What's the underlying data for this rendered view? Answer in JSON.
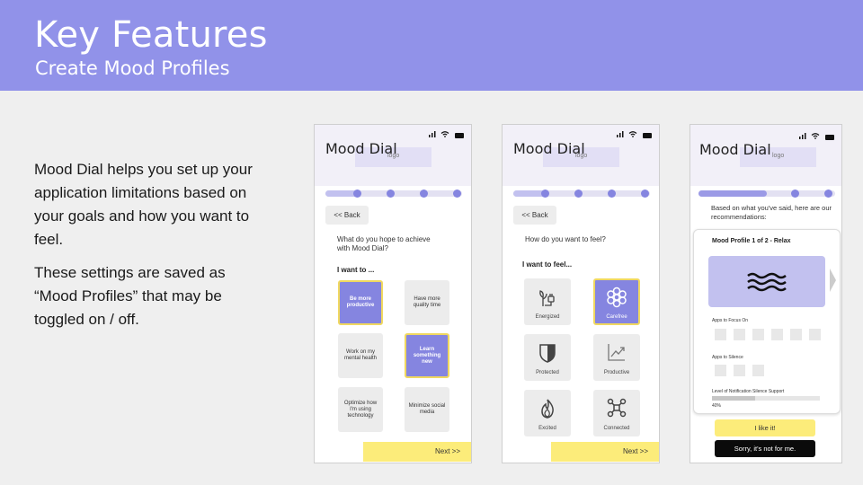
{
  "header": {
    "title": "Key Features",
    "subtitle": "Create Mood Profiles"
  },
  "description": {
    "p1": "Mood Dial helps you set up your application limitations based on your goals and how you want to feel.",
    "p2": "These settings are saved as “Mood Profiles” that may be toggled on / off."
  },
  "app": {
    "name": "Mood Dial",
    "logo_label": "logo"
  },
  "screen1": {
    "back": "<< Back",
    "question": "What do you hope to achieve with Mood Dial?",
    "prompt": "I want to ...",
    "options": [
      {
        "label": "Be more productive",
        "selected": true
      },
      {
        "label": "Have more quality time",
        "selected": false
      },
      {
        "label": "Work on my mental health",
        "selected": false
      },
      {
        "label": "Learn something new",
        "selected": true
      },
      {
        "label": "Optimize how I'm using technology",
        "selected": false
      },
      {
        "label": "Minimize social media",
        "selected": false
      }
    ],
    "next": "Next >>",
    "progress": 0.25
  },
  "screen2": {
    "back": "<< Back",
    "question": "How do you want to feel?",
    "prompt": "I want to feel...",
    "options": [
      {
        "label": "Energized",
        "icon": "plug-plant-icon",
        "selected": false
      },
      {
        "label": "Carefree",
        "icon": "flower-icon",
        "selected": true
      },
      {
        "label": "Protected",
        "icon": "shield-icon",
        "selected": false
      },
      {
        "label": "Productive",
        "icon": "trend-up-icon",
        "selected": false
      },
      {
        "label": "Excited",
        "icon": "flame-icon",
        "selected": false
      },
      {
        "label": "Connected",
        "icon": "network-icon",
        "selected": false
      }
    ],
    "next": "Next >>",
    "progress": 0.25
  },
  "screen3": {
    "intro": "Based on what you've said, here are our recommendations:",
    "card_title": "Mood Profile 1 of 2 - Relax",
    "hero_icon": "waves-icon",
    "apps_focus_label": "Apps to Focus On",
    "apps_silence_label": "Apps to Silence",
    "silence_level_label": "Level of Notification Silence Support",
    "silence_level_value": "40%",
    "like": "I like it!",
    "dislike": "Sorry, it's not for me.",
    "progress": 0.5
  },
  "colors": {
    "header": "#9192e9",
    "accent": "#8585e0",
    "accent_light": "#c2c1ef",
    "button_yellow": "#fcec7a"
  }
}
